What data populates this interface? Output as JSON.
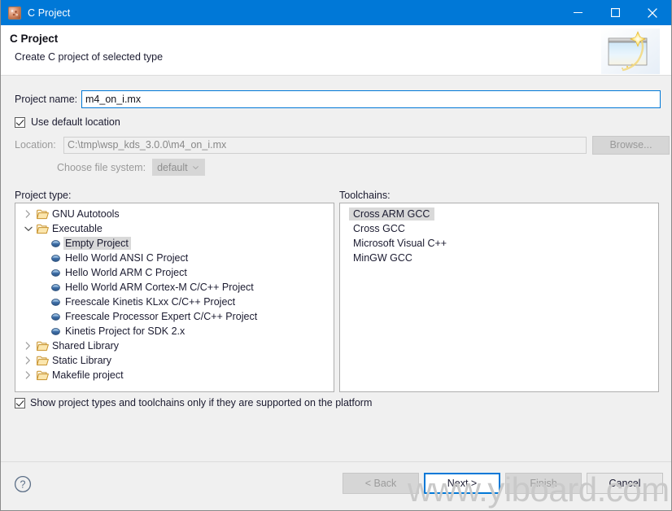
{
  "window": {
    "title": "C Project",
    "icon": "app-icon",
    "controls": {
      "minimize": "minimize-icon",
      "maximize": "maximize-icon",
      "close": "close-icon"
    }
  },
  "header": {
    "title": "C Project",
    "subtitle": "Create C project of selected type",
    "banner_icon": "new-project-wizard-icon"
  },
  "form": {
    "project_name_label": "Project name:",
    "project_name_value": "m4_on_i.mx",
    "project_name_placeholder": "",
    "use_default_location_label": "Use default location",
    "use_default_location_checked": true,
    "location_label": "Location:",
    "location_value": "C:\\tmp\\wsp_kds_3.0.0\\m4_on_i.mx",
    "browse_label": "Browse...",
    "browse_enabled": false,
    "file_system_label": "Choose file system:",
    "file_system_value": "default",
    "file_system_enabled": false
  },
  "project_type": {
    "caption": "Project type:",
    "nodes": [
      {
        "label": "GNU Autotools",
        "level": 0,
        "kind": "folder",
        "expanded": false,
        "selected": false
      },
      {
        "label": "Executable",
        "level": 0,
        "kind": "folder",
        "expanded": true,
        "selected": false
      },
      {
        "label": "Empty Project",
        "level": 1,
        "kind": "leaf",
        "expanded": null,
        "selected": true
      },
      {
        "label": "Hello World ANSI C Project",
        "level": 1,
        "kind": "leaf",
        "expanded": null,
        "selected": false
      },
      {
        "label": "Hello World ARM C Project",
        "level": 1,
        "kind": "leaf",
        "expanded": null,
        "selected": false
      },
      {
        "label": "Hello World ARM Cortex-M C/C++ Project",
        "level": 1,
        "kind": "leaf",
        "expanded": null,
        "selected": false
      },
      {
        "label": "Freescale Kinetis KLxx C/C++ Project",
        "level": 1,
        "kind": "leaf",
        "expanded": null,
        "selected": false
      },
      {
        "label": "Freescale Processor Expert C/C++ Project",
        "level": 1,
        "kind": "leaf",
        "expanded": null,
        "selected": false
      },
      {
        "label": "Kinetis Project for SDK 2.x",
        "level": 1,
        "kind": "leaf",
        "expanded": null,
        "selected": false
      },
      {
        "label": "Shared Library",
        "level": 0,
        "kind": "folder",
        "expanded": false,
        "selected": false
      },
      {
        "label": "Static Library",
        "level": 0,
        "kind": "folder",
        "expanded": false,
        "selected": false
      },
      {
        "label": "Makefile project",
        "level": 0,
        "kind": "folder",
        "expanded": false,
        "selected": false
      }
    ]
  },
  "toolchains": {
    "caption": "Toolchains:",
    "items": [
      {
        "label": "Cross ARM GCC",
        "selected": true
      },
      {
        "label": "Cross GCC",
        "selected": false
      },
      {
        "label": "Microsoft Visual C++",
        "selected": false
      },
      {
        "label": "MinGW GCC",
        "selected": false
      }
    ]
  },
  "options": {
    "show_supported_label": "Show project types and toolchains only if they are supported on the platform",
    "show_supported_checked": true
  },
  "footer": {
    "help_icon": "help-icon",
    "buttons": [
      {
        "label": "< Back",
        "state": "disabled"
      },
      {
        "label": "Next >",
        "state": "default"
      },
      {
        "label": "Finish",
        "state": "disabled"
      },
      {
        "label": "Cancel",
        "state": "enabled"
      }
    ]
  },
  "watermark": {
    "text": "www.yiboard.com"
  },
  "colors": {
    "titlebar": "#0078d7",
    "accent": "#0078d7",
    "dialog_bg": "#f0f0f0",
    "panel_bg": "#ffffff",
    "selection": "#d9d9d9",
    "folder": "#e3a93c",
    "leaf_bullet": "#4a7ebb",
    "disabled_text": "#9a9a9a"
  }
}
